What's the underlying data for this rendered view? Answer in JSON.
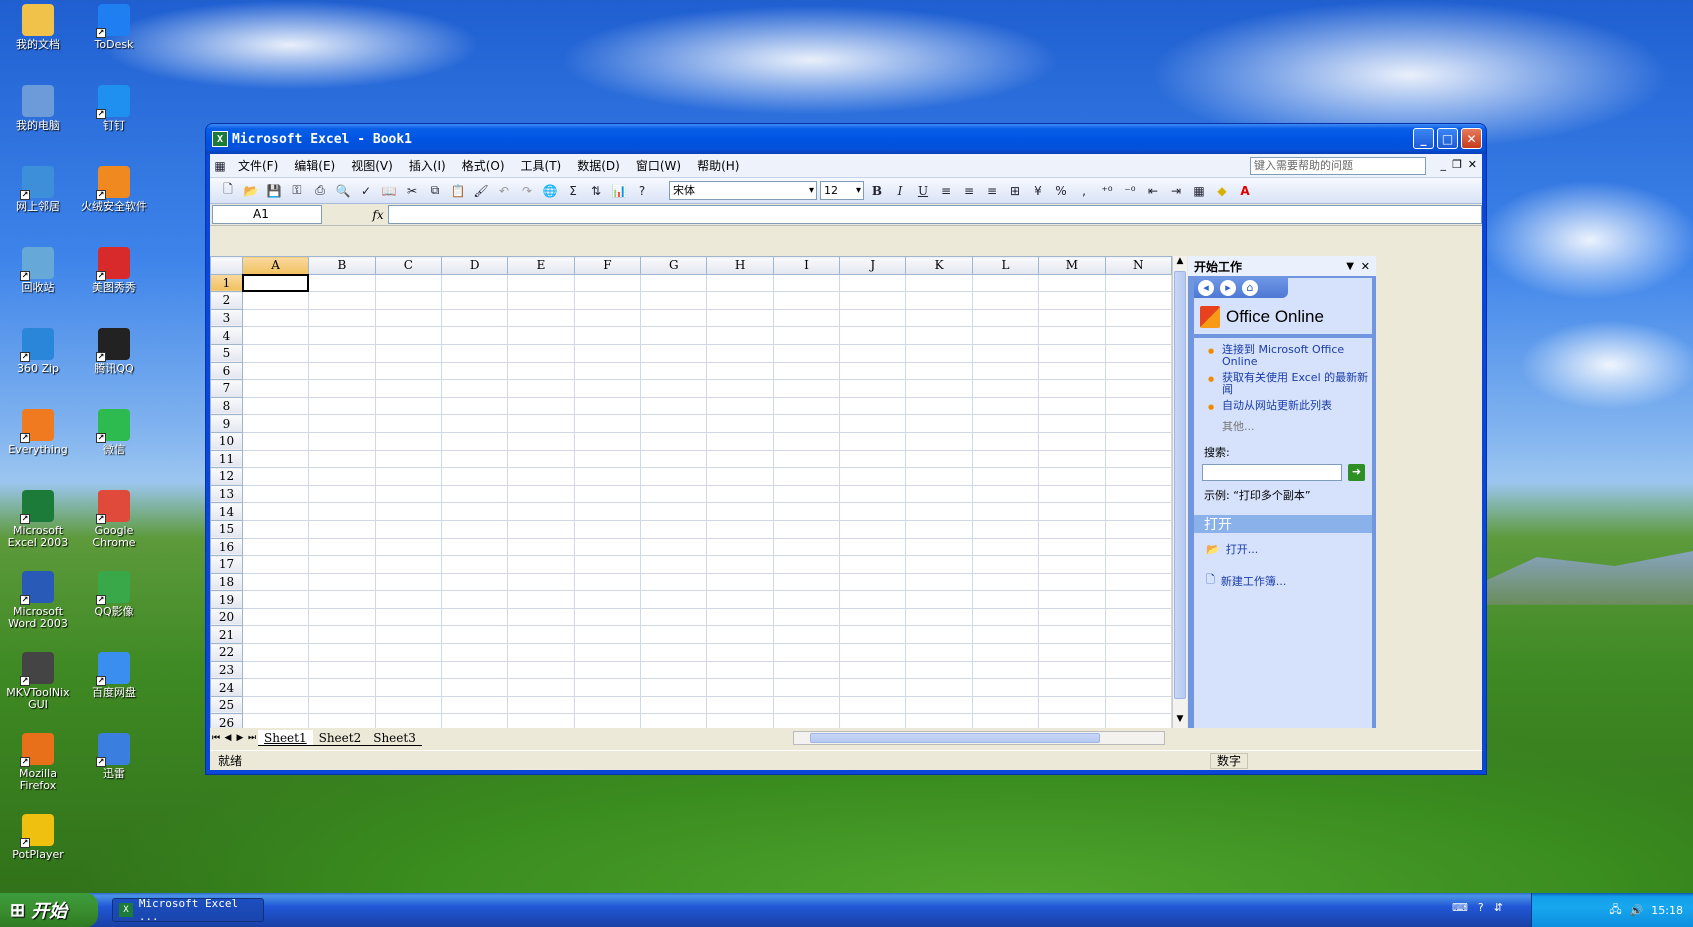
{
  "desktop": {
    "icons": [
      {
        "label": "我的文档",
        "color": "#f0c24a"
      },
      {
        "label": "ToDesk",
        "color": "#1f7ff0"
      },
      {
        "label": "我的电脑",
        "color": "#6d9ad8"
      },
      {
        "label": "钉钉",
        "color": "#1f8ff0"
      },
      {
        "label": "网上邻居",
        "color": "#3c8fd8"
      },
      {
        "label": "火绒安全软件",
        "color": "#f08a20"
      },
      {
        "label": "回收站",
        "color": "#66a8d8"
      },
      {
        "label": "美图秀秀",
        "color": "#d82a2a"
      },
      {
        "label": "360 Zip",
        "color": "#2a86d8"
      },
      {
        "label": "腾讯QQ",
        "color": "#222222"
      },
      {
        "label": "Everything",
        "color": "#f07a20"
      },
      {
        "label": "微信",
        "color": "#2dba4e"
      },
      {
        "label": "Microsoft Excel 2003",
        "color": "#1d7b3a"
      },
      {
        "label": "Google Chrome",
        "color": "#e04a3a"
      },
      {
        "label": "Microsoft Word 2003",
        "color": "#2a5ab8"
      },
      {
        "label": "QQ影像",
        "color": "#38a848"
      },
      {
        "label": "MKVToolNix GUI",
        "color": "#444444"
      },
      {
        "label": "百度网盘",
        "color": "#3a8ef0"
      },
      {
        "label": "Mozilla Firefox",
        "color": "#e8701a"
      },
      {
        "label": "迅雷",
        "color": "#3a7ee0"
      },
      {
        "label": "PotPlayer",
        "color": "#f0c010"
      }
    ]
  },
  "window": {
    "title": "Microsoft Excel - Book1",
    "menu": [
      "文件(F)",
      "编辑(E)",
      "视图(V)",
      "插入(I)",
      "格式(O)",
      "工具(T)",
      "数据(D)",
      "窗口(W)",
      "帮助(H)"
    ],
    "help_placeholder": "键入需要帮助的问题",
    "font_name": "宋体",
    "font_size": "12",
    "name_box": "A1",
    "fx": "fx",
    "columns": [
      "A",
      "B",
      "C",
      "D",
      "E",
      "F",
      "G",
      "H",
      "I",
      "J",
      "K",
      "L",
      "M",
      "N"
    ],
    "rows": [
      "1",
      "2",
      "3",
      "4",
      "5",
      "6",
      "7",
      "8",
      "9",
      "10",
      "11",
      "12",
      "13",
      "14",
      "15",
      "16",
      "17",
      "18",
      "19",
      "20",
      "21",
      "22",
      "23",
      "24",
      "25",
      "26"
    ],
    "sheets": [
      "Sheet1",
      "Sheet2",
      "Sheet3"
    ],
    "status": "就绪",
    "status_mode": "数字"
  },
  "task_pane": {
    "title": "开始工作",
    "office_online": "Office Online",
    "links": [
      "连接到 Microsoft Office Online",
      "获取有关使用 Excel 的最新新闻",
      "自动从网站更新此列表"
    ],
    "more": "其他...",
    "search_label": "搜索:",
    "example": "示例: “打印多个副本”",
    "open_section": "打开",
    "open_item": "打开...",
    "new_item": "新建工作簿..."
  },
  "taskbar": {
    "start": "开始",
    "task": "Microsoft Excel ...",
    "clock": "15:18"
  }
}
